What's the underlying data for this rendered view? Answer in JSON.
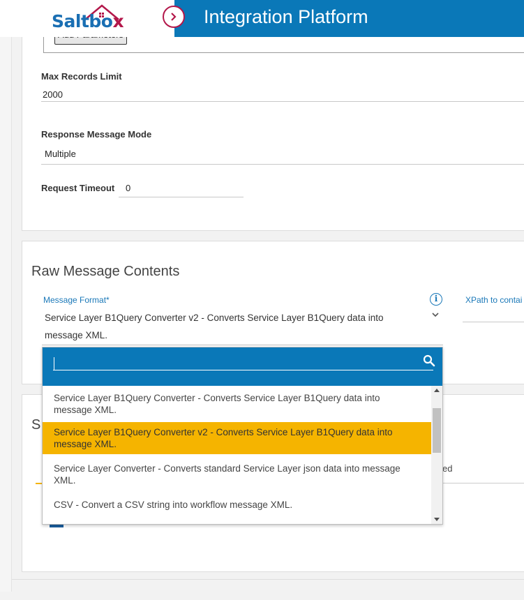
{
  "header": {
    "logo_text_a": "Saltbo",
    "logo_text_b": "x",
    "title": "Integration Platform",
    "toggle_icon": "chevron-right-icon"
  },
  "config": {
    "add_parameters_label": "Add Parameters",
    "max_records_label": "Max Records Limit",
    "max_records_value": "2000",
    "response_mode_label": "Response Message Mode",
    "response_mode_value": "Multiple",
    "request_timeout_label": "Request Timeout",
    "request_timeout_value": "0"
  },
  "raw_message": {
    "section_title": "Raw Message Contents",
    "format_label": "Message Format*",
    "format_value": "Service Layer B1Query Converter v2 - Converts Service Layer B1Query data into message XML.",
    "xpath_label": "XPath to contai"
  },
  "dropdown": {
    "search_value": "",
    "items": [
      {
        "label": "Service Layer B1Query Converter - Converts Service Layer B1Query data into message XML."
      },
      {
        "label": "Service Layer B1Query Converter v2 - Converts Service Layer B1Query data into message XML."
      },
      {
        "label": "Service Layer Converter - Converts standard Service Layer json data into message XML."
      },
      {
        "label": "CSV - Convert a CSV string into workflow message XML."
      }
    ],
    "selected_index": 1
  },
  "panel3": {
    "partial_title": "S",
    "partial_text": "ed"
  },
  "colors": {
    "header_blue": "#0a78b8",
    "brand_red": "#b3174a",
    "highlight": "#f5b400"
  }
}
